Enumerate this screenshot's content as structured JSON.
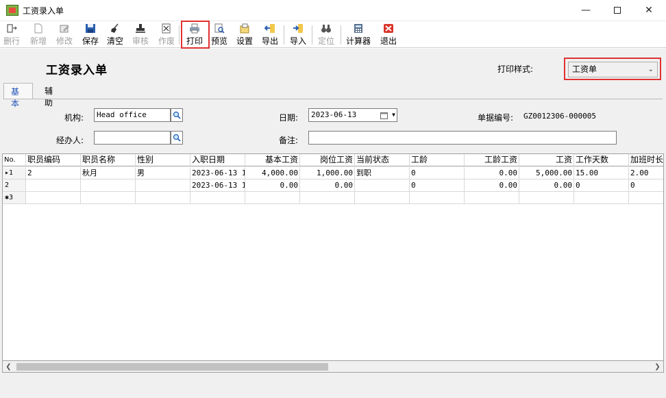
{
  "window": {
    "title": "工资录入单",
    "minimize": "—",
    "close": "✕"
  },
  "toolbar": {
    "items": [
      {
        "label": "删行",
        "icon": "delete-row-icon",
        "enabled": false
      },
      {
        "label": "新增",
        "icon": "new-document-icon",
        "enabled": false
      },
      {
        "label": "修改",
        "icon": "edit-icon",
        "enabled": false
      },
      {
        "label": "保存",
        "icon": "save-disk-icon",
        "enabled": true
      },
      {
        "label": "清空",
        "icon": "clear-broom-icon",
        "enabled": true
      },
      {
        "label": "审核",
        "icon": "approve-stamp-icon",
        "enabled": false
      },
      {
        "label": "作废",
        "icon": "void-icon",
        "enabled": false
      },
      {
        "label": "打印",
        "icon": "printer-icon",
        "enabled": true
      },
      {
        "label": "预览",
        "icon": "preview-magnifier-icon",
        "enabled": true
      },
      {
        "label": "设置",
        "icon": "settings-icon",
        "enabled": true
      },
      {
        "label": "导出",
        "icon": "export-icon",
        "enabled": true
      },
      {
        "label": "导入",
        "icon": "import-icon",
        "enabled": true
      },
      {
        "label": "定位",
        "icon": "binoculars-icon",
        "enabled": false
      },
      {
        "label": "计算器",
        "icon": "calculator-icon",
        "enabled": true
      },
      {
        "label": "退出",
        "icon": "exit-icon",
        "enabled": true
      }
    ]
  },
  "header": {
    "page_title": "工资录入单",
    "print_style_label": "打印样式:",
    "print_style_value": "工资单"
  },
  "tabs": [
    {
      "label": "基本"
    },
    {
      "label": "辅助"
    }
  ],
  "form": {
    "org_label": "机构:",
    "org_value": "Head office",
    "handler_label": "经办人:",
    "handler_value": "",
    "date_label": "日期:",
    "date_value": "2023-06-13",
    "note_label": "备注:",
    "note_value": "",
    "doc_no_label": "单据编号:",
    "doc_no_value": "GZ0012306-000005"
  },
  "grid": {
    "columns": [
      "No.",
      "职员编码",
      "职员名称",
      "性别",
      "入职日期",
      "基本工资",
      "岗位工资",
      "当前状态",
      "工龄",
      "工龄工资",
      "工资",
      "工作天数",
      "加班时长"
    ],
    "rows": [
      [
        "▸1",
        "2",
        "秋月",
        "男",
        "2023-06-13 1",
        "4,000.00",
        "1,000.00",
        "到职",
        "0",
        "0.00",
        "5,000.00",
        "15.00",
        "2.00"
      ],
      [
        "2",
        "",
        "",
        "",
        "2023-06-13 1",
        "0.00",
        "0.00",
        "",
        "0",
        "0.00",
        "0.00",
        "0",
        "0"
      ],
      [
        "✱3",
        "",
        "",
        "",
        "",
        "",
        "",
        "",
        "",
        "",
        "",
        "",
        ""
      ]
    ]
  },
  "colors": {
    "highlight": "#e03030",
    "tab_active_text": "#1e4fb5"
  }
}
